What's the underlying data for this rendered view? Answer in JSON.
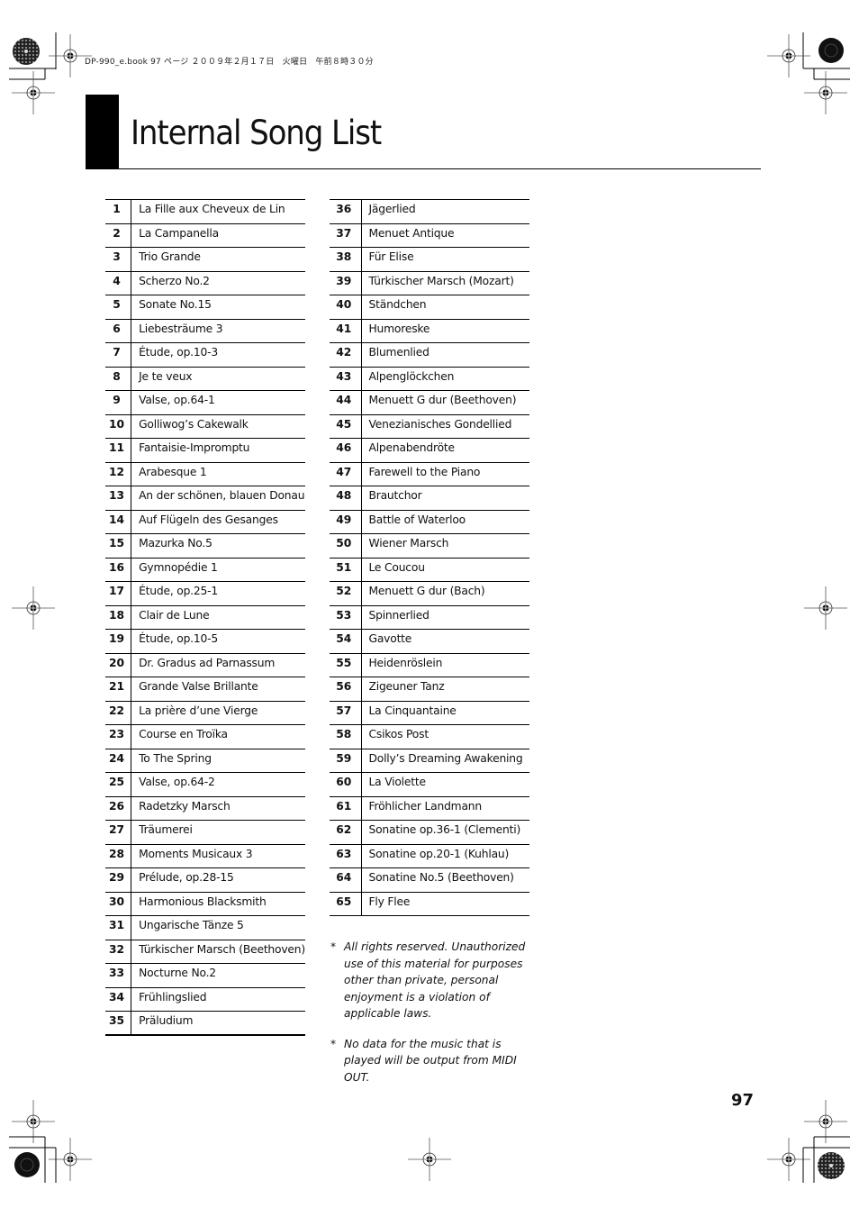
{
  "print_header": "DP-990_e.book 97 ページ ２００９年２月１７日　火曜日　午前８時３０分",
  "title": "Internal Song List",
  "left_column": [
    {
      "num": "1",
      "name": "La Fille aux Cheveux de Lin"
    },
    {
      "num": "2",
      "name": "La Campanella"
    },
    {
      "num": "3",
      "name": "Trio Grande"
    },
    {
      "num": "4",
      "name": "Scherzo No.2"
    },
    {
      "num": "5",
      "name": "Sonate No.15"
    },
    {
      "num": "6",
      "name": "Liebesträume 3"
    },
    {
      "num": "7",
      "name": "Étude, op.10-3"
    },
    {
      "num": "8",
      "name": "Je te veux"
    },
    {
      "num": "9",
      "name": "Valse, op.64-1"
    },
    {
      "num": "10",
      "name": "Golliwog’s Cakewalk"
    },
    {
      "num": "11",
      "name": "Fantaisie-Impromptu"
    },
    {
      "num": "12",
      "name": "Arabesque 1"
    },
    {
      "num": "13",
      "name": "An der schönen, blauen Donau"
    },
    {
      "num": "14",
      "name": "Auf Flügeln des Gesanges"
    },
    {
      "num": "15",
      "name": "Mazurka No.5"
    },
    {
      "num": "16",
      "name": "Gymnopédie 1"
    },
    {
      "num": "17",
      "name": "Étude, op.25-1"
    },
    {
      "num": "18",
      "name": "Clair de Lune"
    },
    {
      "num": "19",
      "name": "Étude, op.10-5"
    },
    {
      "num": "20",
      "name": "Dr. Gradus ad Parnassum"
    },
    {
      "num": "21",
      "name": "Grande Valse Brillante"
    },
    {
      "num": "22",
      "name": "La prière d’une Vierge"
    },
    {
      "num": "23",
      "name": "Course en Troïka"
    },
    {
      "num": "24",
      "name": "To The Spring"
    },
    {
      "num": "25",
      "name": "Valse, op.64-2"
    },
    {
      "num": "26",
      "name": "Radetzky Marsch"
    },
    {
      "num": "27",
      "name": "Träumerei"
    },
    {
      "num": "28",
      "name": "Moments Musicaux 3"
    },
    {
      "num": "29",
      "name": "Prélude, op.28-15"
    },
    {
      "num": "30",
      "name": "Harmonious Blacksmith"
    },
    {
      "num": "31",
      "name": "Ungarische Tänze 5"
    },
    {
      "num": "32",
      "name": "Türkischer Marsch (Beethoven)"
    },
    {
      "num": "33",
      "name": "Nocturne No.2"
    },
    {
      "num": "34",
      "name": "Frühlingslied"
    },
    {
      "num": "35",
      "name": "Präludium"
    }
  ],
  "right_column": [
    {
      "num": "36",
      "name": "Jägerlied"
    },
    {
      "num": "37",
      "name": "Menuet Antique"
    },
    {
      "num": "38",
      "name": "Für Elise"
    },
    {
      "num": "39",
      "name": "Türkischer Marsch (Mozart)"
    },
    {
      "num": "40",
      "name": "Ständchen"
    },
    {
      "num": "41",
      "name": "Humoreske"
    },
    {
      "num": "42",
      "name": "Blumenlied"
    },
    {
      "num": "43",
      "name": "Alpenglöckchen"
    },
    {
      "num": "44",
      "name": "Menuett G dur (Beethoven)"
    },
    {
      "num": "45",
      "name": "Venezianisches Gondellied"
    },
    {
      "num": "46",
      "name": "Alpenabendröte"
    },
    {
      "num": "47",
      "name": "Farewell to the Piano"
    },
    {
      "num": "48",
      "name": "Brautchor"
    },
    {
      "num": "49",
      "name": "Battle of Waterloo"
    },
    {
      "num": "50",
      "name": "Wiener Marsch"
    },
    {
      "num": "51",
      "name": "Le Coucou"
    },
    {
      "num": "52",
      "name": "Menuett G dur (Bach)"
    },
    {
      "num": "53",
      "name": "Spinnerlied"
    },
    {
      "num": "54",
      "name": "Gavotte"
    },
    {
      "num": "55",
      "name": "Heidenröslein"
    },
    {
      "num": "56",
      "name": "Zigeuner Tanz"
    },
    {
      "num": "57",
      "name": "La Cinquantaine"
    },
    {
      "num": "58",
      "name": "Csikos Post"
    },
    {
      "num": "59",
      "name": "Dolly’s Dreaming Awakening"
    },
    {
      "num": "60",
      "name": "La Violette"
    },
    {
      "num": "61",
      "name": "Fröhlicher Landmann"
    },
    {
      "num": "62",
      "name": "Sonatine op.36-1 (Clementi)"
    },
    {
      "num": "63",
      "name": "Sonatine op.20-1 (Kuhlau)"
    },
    {
      "num": "64",
      "name": "Sonatine No.5 (Beethoven)"
    },
    {
      "num": "65",
      "name": "Fly Flee"
    }
  ],
  "notes": [
    {
      "marker": "*",
      "text": "All rights reserved. Unauthorized use of this material for purposes other than private, personal enjoyment is a violation of applicable laws."
    },
    {
      "marker": "*",
      "text": "No data for the music that is played will be output from MIDI OUT."
    }
  ],
  "page_number": "97",
  "icons": {
    "registration_mark": "registration-mark-icon",
    "color_target": "color-target-icon"
  }
}
